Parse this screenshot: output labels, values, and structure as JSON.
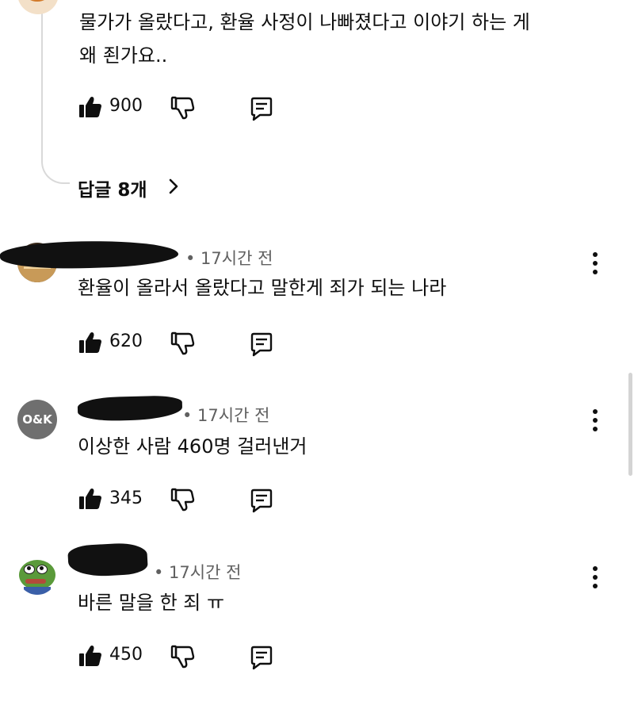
{
  "top_comment": {
    "text_line1": "물가가 올랐다고, 환율 사정이 나빠졌다고 이야기 하는 게",
    "text_line2": "왜 죈가요..",
    "likes": "900",
    "replies_label": "답글 8개"
  },
  "comments": [
    {
      "time": "• 17시간 전",
      "text": "환율이 올라서 올랐다고 말한게 죄가 되는 나라",
      "likes": "620"
    },
    {
      "avatar_text": "O&K",
      "time": "• 17시간 전",
      "text": "이상한 사람 460명 걸러낸거",
      "likes": "345"
    },
    {
      "time": "• 17시간 전",
      "text": "바른 말을 한 죄 ㅠ",
      "likes": "450"
    }
  ],
  "icons": {
    "like": "thumbs-up-icon",
    "dislike": "thumbs-down-icon",
    "reply": "comment-icon",
    "more": "more-vertical-icon",
    "chevron": "chevron-right-icon"
  },
  "colors": {
    "avatar_gray": "#6f6f6f",
    "meta_gray": "#606060"
  }
}
